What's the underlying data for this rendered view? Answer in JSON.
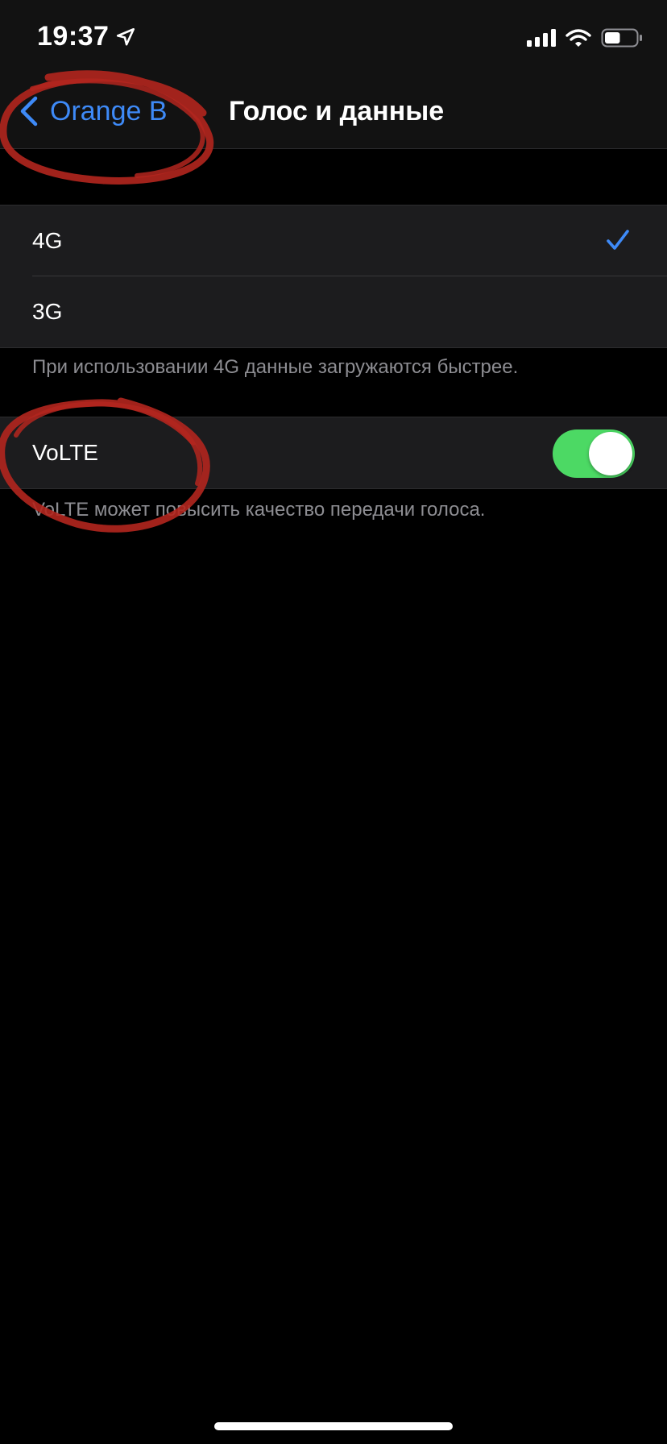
{
  "status_bar": {
    "time": "19:37",
    "location_icon": "location-arrow-icon",
    "signal_icon": "cellular-signal-icon",
    "wifi_icon": "wifi-icon",
    "battery_icon": "battery-icon",
    "battery_level": 0.5
  },
  "nav": {
    "back_label": "Orange B",
    "title": "Голос и данные"
  },
  "network_options": {
    "items": [
      {
        "label": "4G",
        "selected": true
      },
      {
        "label": "3G",
        "selected": false
      }
    ],
    "footer": "При использовании 4G данные загружаются быстрее."
  },
  "volte": {
    "label": "VoLTE",
    "enabled": true,
    "footer": "VoLTE может повысить качество передачи голоса."
  },
  "colors": {
    "accent": "#3e8af7",
    "toggle_on": "#4cd964",
    "annotation": "#b3261e"
  }
}
